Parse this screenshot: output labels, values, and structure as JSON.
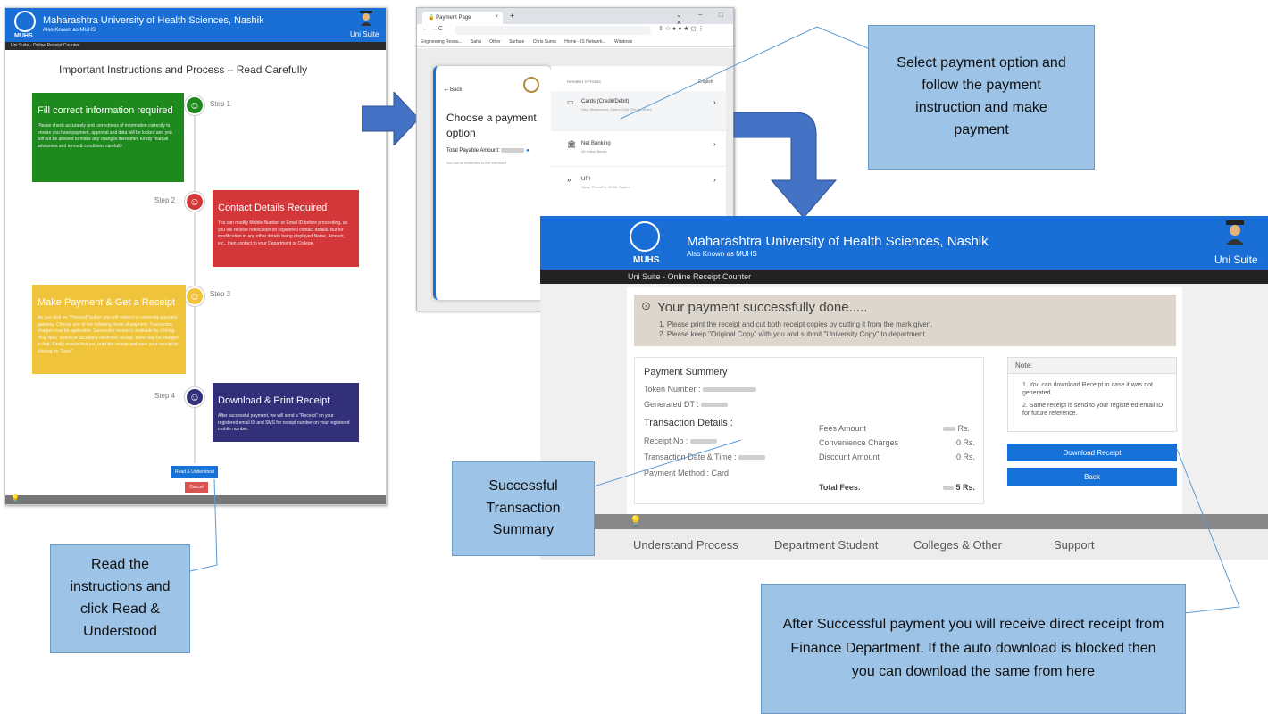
{
  "left_panel": {
    "university": "Maharashtra University of Health Sciences, Nashik",
    "aka": "Also Known as MUHS",
    "logo_text": "MUHS",
    "suite": "Uni Suite",
    "subbar": "Uni Suite - Online Receipt Counter",
    "heading": "Important Instructions and Process – Read Carefully",
    "steps": [
      {
        "label": "Step 1",
        "title": "Fill correct information required",
        "body": "Please check accurately and correctness of information correctly to ensure you have payment, approval and data will be locked and you will not be allowed to make any changes thereafter. Kindly read all advisories and terms & conditions carefully."
      },
      {
        "label": "Step 2",
        "title": "Contact Details Required",
        "body": "You can modify Mobile Number or Email ID before proceeding, as you will receive notification on registered contact details. But for modification in any other details being displayed Name, Amount, etc., then contact to your Department or College."
      },
      {
        "label": "Step 3",
        "title": "Make Payment & Get a Receipt",
        "body": "As you click on \"Proceed\" button you will redirect to university payment gateway. Choose one of the following mode of payment. Transaction charges may be applicable. Successful receipt is available by clicking \"Pay Now\" button or accepting electronic receipt; there may be charges in that. Kindly ensure that you print the receipt and save your receipt by clicking on \"Save\"."
      },
      {
        "label": "Step 4",
        "title": "Download & Print Receipt",
        "body": "After successful payment, we will send a \"Receipt\" on your registered email ID and SMS for receipt number on your registered mobile number."
      }
    ],
    "read_button": "Read & Understood",
    "cancel_button": "Cancel"
  },
  "browser": {
    "tab_title": "Payment Page",
    "bookmarks": [
      "Engineering Resou...",
      "Sahu",
      "Other",
      "Surface",
      "Chris Suma",
      "Home - IS Network...",
      "Windows"
    ],
    "back": "Back",
    "choose_heading": "Choose a payment option",
    "total_label": "Total Payable Amount:",
    "note": "You will be redirected to the merchant",
    "options_header": "PAYMENT OPTIONS",
    "language": "English",
    "options": [
      {
        "name": "Cards (Credit/Debit)",
        "sub": "Visa, Mastercard, Diners Club, Rupay, Amex"
      },
      {
        "name": "Net Banking",
        "sub": "All Indian Banks"
      },
      {
        "name": "UPI",
        "sub": "Gpay, PhonePe, BHIM, Paytm"
      }
    ]
  },
  "receipt_page": {
    "university": "Maharashtra University of Health Sciences, Nashik",
    "aka": "Also Known as MUHS",
    "logo_text": "MUHS",
    "suite": "Uni Suite",
    "subbar": "Uni Suite - Online Receipt Counter",
    "success_title": "Your payment successfully done.....",
    "success_lines": [
      "1. Please print the receipt and cut both receipt copies by cutting it from the mark given.",
      "2. Please keep \"Original Copy\" with you and submit \"University Copy\" to department."
    ],
    "summary_title": "Payment Summery",
    "token_label": "Token Number :",
    "generated_label": "Generated DT :",
    "transaction_title": "Transaction Details :",
    "receipt_no_label": "Receipt No :",
    "txn_date_label": "Transaction Date & Time :",
    "payment_method": "Payment Method : Card",
    "fees_amount_label": "Fees Amount",
    "fees_amount_value": "Rs.",
    "convenience_label": "Convenience Charges",
    "convenience_value": "0 Rs.",
    "discount_label": "Discount Amount",
    "discount_value": "0 Rs.",
    "total_label": "Total Fees:",
    "total_value": "5 Rs.",
    "note_title": "Note:",
    "note_items": [
      "1. You can download Receipt in case it was not generated.",
      "2. Same receipt is send to your registered email ID for future reference."
    ],
    "download_button": "Download Receipt",
    "back_button": "Back",
    "footer_links": [
      "Understand Process",
      "Department Student",
      "Colleges & Other",
      "Support"
    ]
  },
  "callouts": {
    "select_payment": "Select payment option and follow the payment instruction and make payment",
    "success_summary": "Successful Transaction Summary",
    "read_instructions": "Read the instructions and click Read & Understood",
    "after_payment": "After Successful payment you will receive direct receipt from Finance Department. If the auto download is blocked then you can download the same from here"
  },
  "colors": {
    "header_blue": "#1a6fd6",
    "step1": "#1e8a1e",
    "step2": "#d4373a",
    "step3": "#efc33a",
    "step4": "#33307a",
    "callout": "#9dc3e6",
    "arrow": "#4472c4"
  }
}
